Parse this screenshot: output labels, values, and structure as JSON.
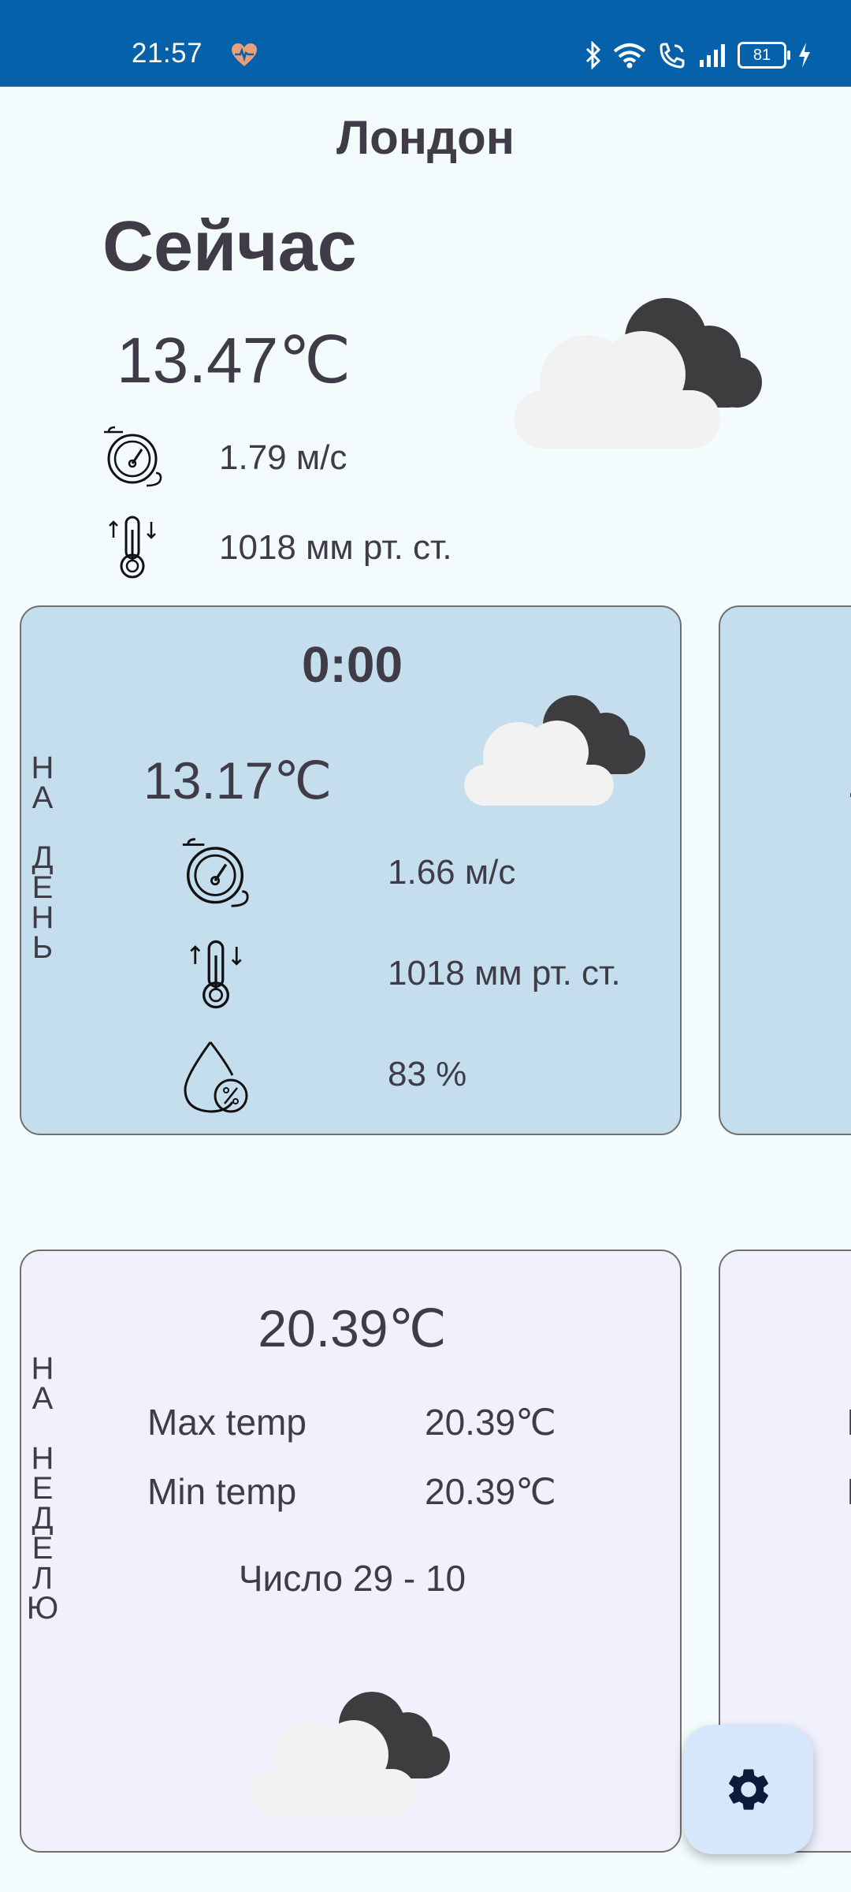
{
  "status_bar": {
    "time": "21:57",
    "battery": "81",
    "icons": [
      "heart-pulse-icon",
      "bluetooth-icon",
      "wifi-icon",
      "wifi-calling-icon",
      "signal-icon",
      "battery-icon",
      "charging-icon"
    ]
  },
  "city": "Лондон",
  "now": {
    "title": "Сейчас",
    "temp": "13.47℃",
    "wind": "1.79 м/с",
    "pressure": "1018 мм рт. ст.",
    "icon": "cloud-icon"
  },
  "day_forecast": {
    "vertical_label": [
      "Н",
      "А",
      "",
      "Д",
      "Е",
      "Н",
      "Ь"
    ],
    "time": "0:00",
    "temp": "13.17℃",
    "wind": "1.66 м/с",
    "pressure": "1018 мм рт. ст.",
    "humidity": "83 %",
    "next_card_peek": "1"
  },
  "week_forecast": {
    "vertical_label": [
      "Н",
      "А",
      "",
      "Н",
      "Е",
      "Д",
      "Е",
      "Л",
      "Ю"
    ],
    "temp": "20.39℃",
    "max_label": "Max temp",
    "max_value": "20.39℃",
    "min_label": "Min temp",
    "min_value": "20.39℃",
    "date": "Число 29 - 10",
    "next_card_peek_1": "I",
    "next_card_peek_2": "I"
  },
  "fab": {
    "icon": "gear-icon"
  },
  "colors": {
    "status_bar": "#0561a9",
    "background": "#f3fbfd",
    "day_card": "#c5deed",
    "week_card": "#f1f1fd",
    "fab": "#d6e6fb",
    "text": "#3f3c48"
  }
}
